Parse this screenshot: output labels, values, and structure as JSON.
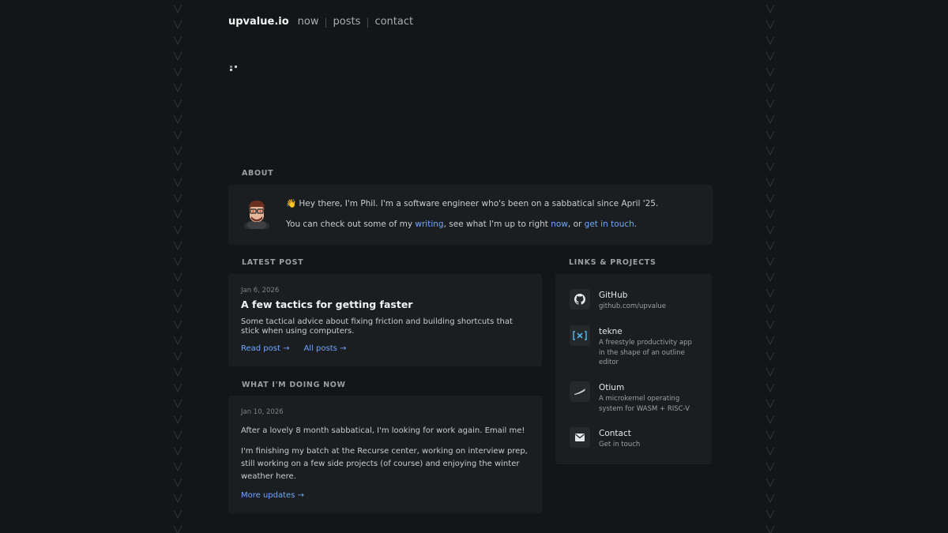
{
  "nav": {
    "brand": "upvalue.io",
    "links": [
      "now",
      "posts",
      "contact"
    ],
    "separator": "|"
  },
  "about": {
    "heading": "ABOUT",
    "greeting": "👋 Hey there, I'm Phil. I'm a software engineer who's been on a sabbatical since April '25.",
    "line2_prefix": "You can check out some of my ",
    "writing_link": "writing",
    "line2_mid1": ", see what I'm up to right ",
    "now_link": "now",
    "line2_mid2": ", or ",
    "contact_link": "get in touch",
    "line2_suffix": "."
  },
  "latest_post": {
    "heading": "LATEST POST",
    "date": "Jan 6, 2026",
    "title": "A few tactics for getting faster",
    "description": "Some tactical advice about fixing friction and building shortcuts that stick when using computers.",
    "read_label": "Read post →",
    "all_label": "All posts →"
  },
  "now": {
    "heading": "WHAT I'M DOING NOW",
    "date": "Jan 10, 2026",
    "para1": "After a lovely 8 month sabbatical, I'm looking for work again. Email me!",
    "para2": "I'm finishing my batch at the Recurse center, working on interview prep, still working on a few side projects (of course) and enjoying the winter weather here.",
    "more_label": "More updates →"
  },
  "links": {
    "heading": "LINKS & PROJECTS",
    "items": [
      {
        "title": "GitHub",
        "desc": "github.com/upvalue",
        "icon": "github-icon"
      },
      {
        "title": "tekne",
        "desc": "A freestyle productivity app in the shape of an outline editor",
        "icon": "tekne-icon"
      },
      {
        "title": "Otium",
        "desc": "A microkernel operating system for WASM + RISC-V",
        "icon": "otium-icon"
      },
      {
        "title": "Contact",
        "desc": "Get in touch",
        "icon": "mail-icon"
      }
    ]
  },
  "colors": {
    "background": "#121415",
    "card": "#1b1e20",
    "link": "#6fa8ff",
    "text": "#c9cdd1"
  }
}
